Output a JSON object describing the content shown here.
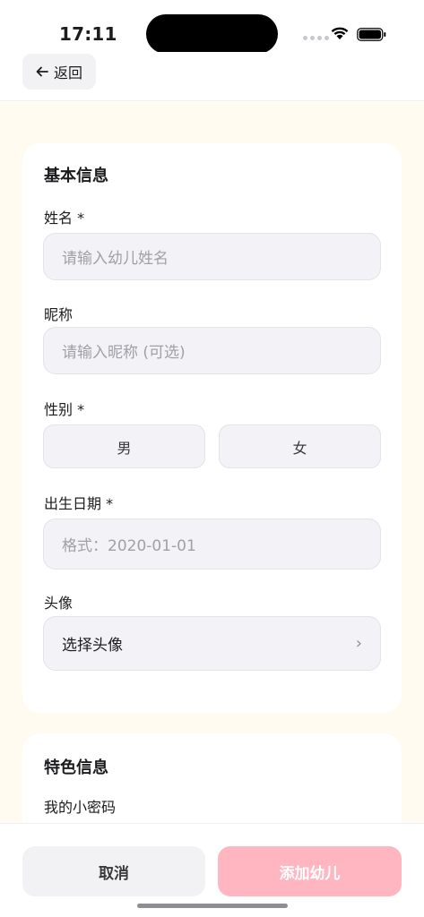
{
  "status_bar": {
    "time": "17:11"
  },
  "header": {
    "back_label": "返回"
  },
  "basic_info": {
    "title": "基本信息",
    "name": {
      "label": "姓名 *",
      "placeholder": "请输入幼儿姓名"
    },
    "nickname": {
      "label": "昵称",
      "placeholder": "请输入昵称 (可选)"
    },
    "gender": {
      "label": "性别 *",
      "options": [
        "男",
        "女"
      ]
    },
    "birthday": {
      "label": "出生日期 *",
      "placeholder": "格式：2020-01-01"
    },
    "avatar": {
      "label": "头像",
      "select_label": "选择头像"
    }
  },
  "feature_info": {
    "title": "特色信息",
    "secret_label": "我的小密码"
  },
  "footer": {
    "cancel_label": "取消",
    "add_label": "添加幼儿"
  },
  "colors": {
    "accent_pink": "#FFB6C1",
    "background": "#FFFBF0"
  }
}
